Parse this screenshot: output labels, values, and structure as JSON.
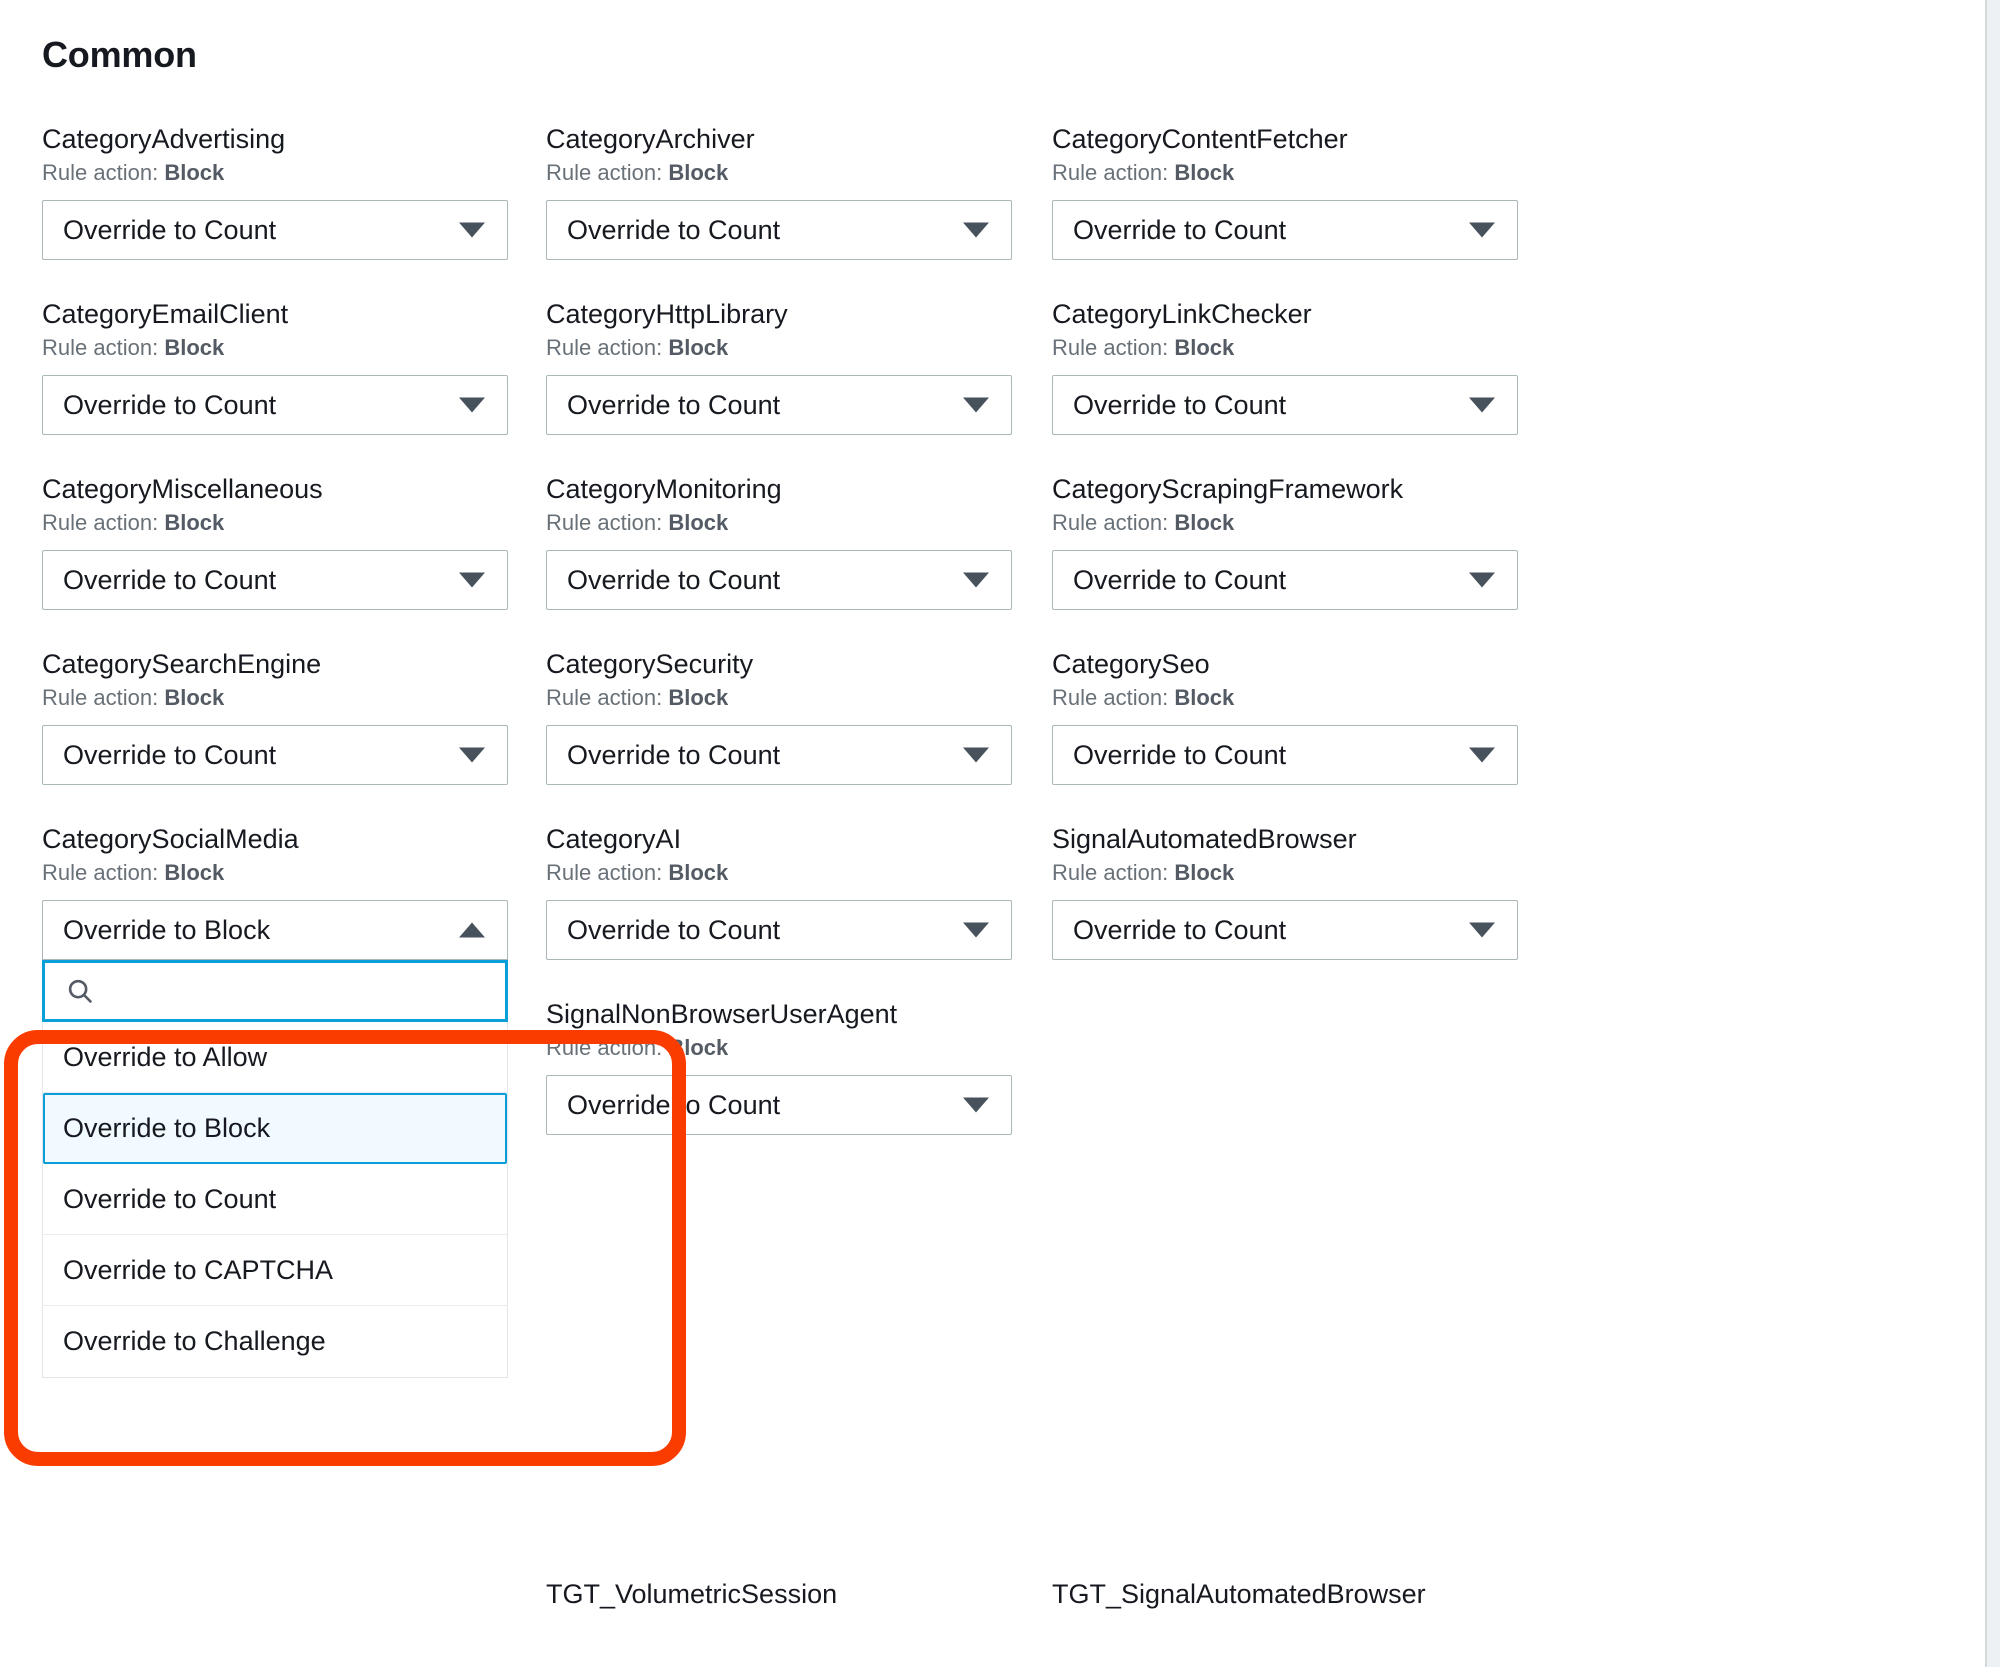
{
  "section": {
    "title": "Common"
  },
  "labels": {
    "rule_action_prefix": "Rule action:"
  },
  "grid": {
    "columns": 3,
    "cells": [
      {
        "name": "CategoryAdvertising",
        "rule_action": "Block",
        "value": "Override to Count",
        "col": 0,
        "row": 0
      },
      {
        "name": "CategoryArchiver",
        "rule_action": "Block",
        "value": "Override to Count",
        "col": 1,
        "row": 0
      },
      {
        "name": "CategoryContentFetcher",
        "rule_action": "Block",
        "value": "Override to Count",
        "col": 2,
        "row": 0
      },
      {
        "name": "CategoryEmailClient",
        "rule_action": "Block",
        "value": "Override to Count",
        "col": 0,
        "row": 1
      },
      {
        "name": "CategoryHttpLibrary",
        "rule_action": "Block",
        "value": "Override to Count",
        "col": 1,
        "row": 1
      },
      {
        "name": "CategoryLinkChecker",
        "rule_action": "Block",
        "value": "Override to Count",
        "col": 2,
        "row": 1
      },
      {
        "name": "CategoryMiscellaneous",
        "rule_action": "Block",
        "value": "Override to Count",
        "col": 0,
        "row": 2
      },
      {
        "name": "CategoryMonitoring",
        "rule_action": "Block",
        "value": "Override to Count",
        "col": 1,
        "row": 2
      },
      {
        "name": "CategoryScrapingFramework",
        "rule_action": "Block",
        "value": "Override to Count",
        "col": 2,
        "row": 2
      },
      {
        "name": "CategorySearchEngine",
        "rule_action": "Block",
        "value": "Override to Count",
        "col": 0,
        "row": 3
      },
      {
        "name": "CategorySecurity",
        "rule_action": "Block",
        "value": "Override to Count",
        "col": 1,
        "row": 3
      },
      {
        "name": "CategorySeo",
        "rule_action": "Block",
        "value": "Override to Count",
        "col": 2,
        "row": 3
      },
      {
        "name": "CategorySocialMedia",
        "rule_action": "Block",
        "value": "Override to Block",
        "col": 0,
        "row": 4,
        "open": true
      },
      {
        "name": "CategoryAI",
        "rule_action": "Block",
        "value": "Override to Count",
        "col": 1,
        "row": 4
      },
      {
        "name": "SignalAutomatedBrowser",
        "rule_action": "Block",
        "value": "Override to Count",
        "col": 2,
        "row": 4
      },
      {
        "name": "SignalNonBrowserUserAgent",
        "rule_action": "Block",
        "value": "Override to Count",
        "col": 1,
        "row": 5
      }
    ],
    "partial_cells": [
      {
        "name": "TGT_VolumetricSession",
        "col": 1
      },
      {
        "name": "TGT_SignalAutomatedBrowser",
        "col": 2
      }
    ]
  },
  "open_dropdown": {
    "owner": "CategorySocialMedia",
    "trigger_value": "Override to Block",
    "search": {
      "value": "",
      "placeholder": "",
      "icon": "search-icon"
    },
    "options": [
      {
        "label": "Override to Allow",
        "selected": false
      },
      {
        "label": "Override to Block",
        "selected": true
      },
      {
        "label": "Override to Count",
        "selected": false
      },
      {
        "label": "Override to CAPTCHA",
        "selected": false
      },
      {
        "label": "Override to Challenge",
        "selected": false
      }
    ]
  },
  "annotation": {
    "type": "highlight-rectangle",
    "color": "#fa3c00"
  },
  "colors": {
    "accent_blue": "#0a9fd8",
    "annotation_red": "#fa3c00",
    "border_gray": "#aab7b8",
    "text_primary": "#16191f",
    "text_secondary": "#687078",
    "option_selected_bg": "#f1faff"
  }
}
